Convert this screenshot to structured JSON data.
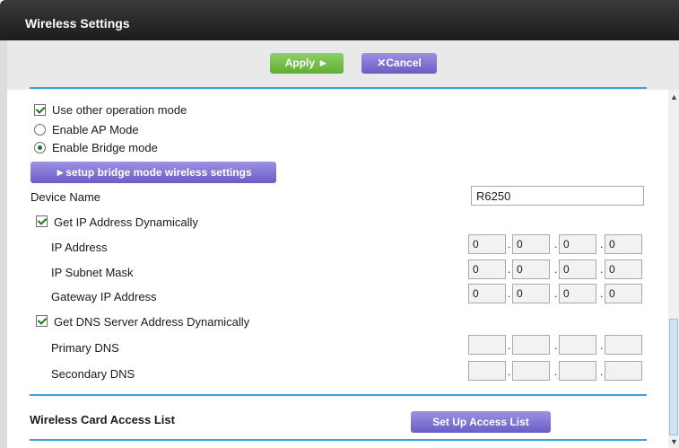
{
  "header": {
    "title": "Wireless Settings"
  },
  "toolbar": {
    "apply_label": "Apply ►",
    "cancel_label": "✕Cancel"
  },
  "mode": {
    "use_other_label": "Use other operation mode",
    "use_other_checked": true,
    "ap_label": "Enable AP Mode",
    "ap_selected": false,
    "bridge_label": "Enable Bridge mode",
    "bridge_selected": true,
    "bridge_button_label": "►setup bridge mode wireless settings"
  },
  "device": {
    "label": "Device Name",
    "value": "R6250"
  },
  "ip": {
    "dynamic_label": "Get IP Address Dynamically",
    "dynamic_checked": true,
    "address_label": "IP Address",
    "address": [
      "0",
      "0",
      "0",
      "0"
    ],
    "subnet_label": "IP Subnet Mask",
    "subnet": [
      "0",
      "0",
      "0",
      "0"
    ],
    "gateway_label": "Gateway IP Address",
    "gateway": [
      "0",
      "0",
      "0",
      "0"
    ]
  },
  "dns": {
    "dynamic_label": "Get DNS Server Address Dynamically",
    "dynamic_checked": true,
    "primary_label": "Primary DNS",
    "primary": [
      "",
      "",
      "",
      ""
    ],
    "secondary_label": "Secondary DNS",
    "secondary": [
      "",
      "",
      "",
      ""
    ]
  },
  "access_list": {
    "label": "Wireless Card Access List",
    "button_label": "Set Up Access List"
  },
  "colors": {
    "accent_rule": "#3ea0d8",
    "apply_green": "#5fae32",
    "purple": "#6b5dc7"
  },
  "icons": {
    "scroll_up": "▲",
    "scroll_down": "▼"
  }
}
